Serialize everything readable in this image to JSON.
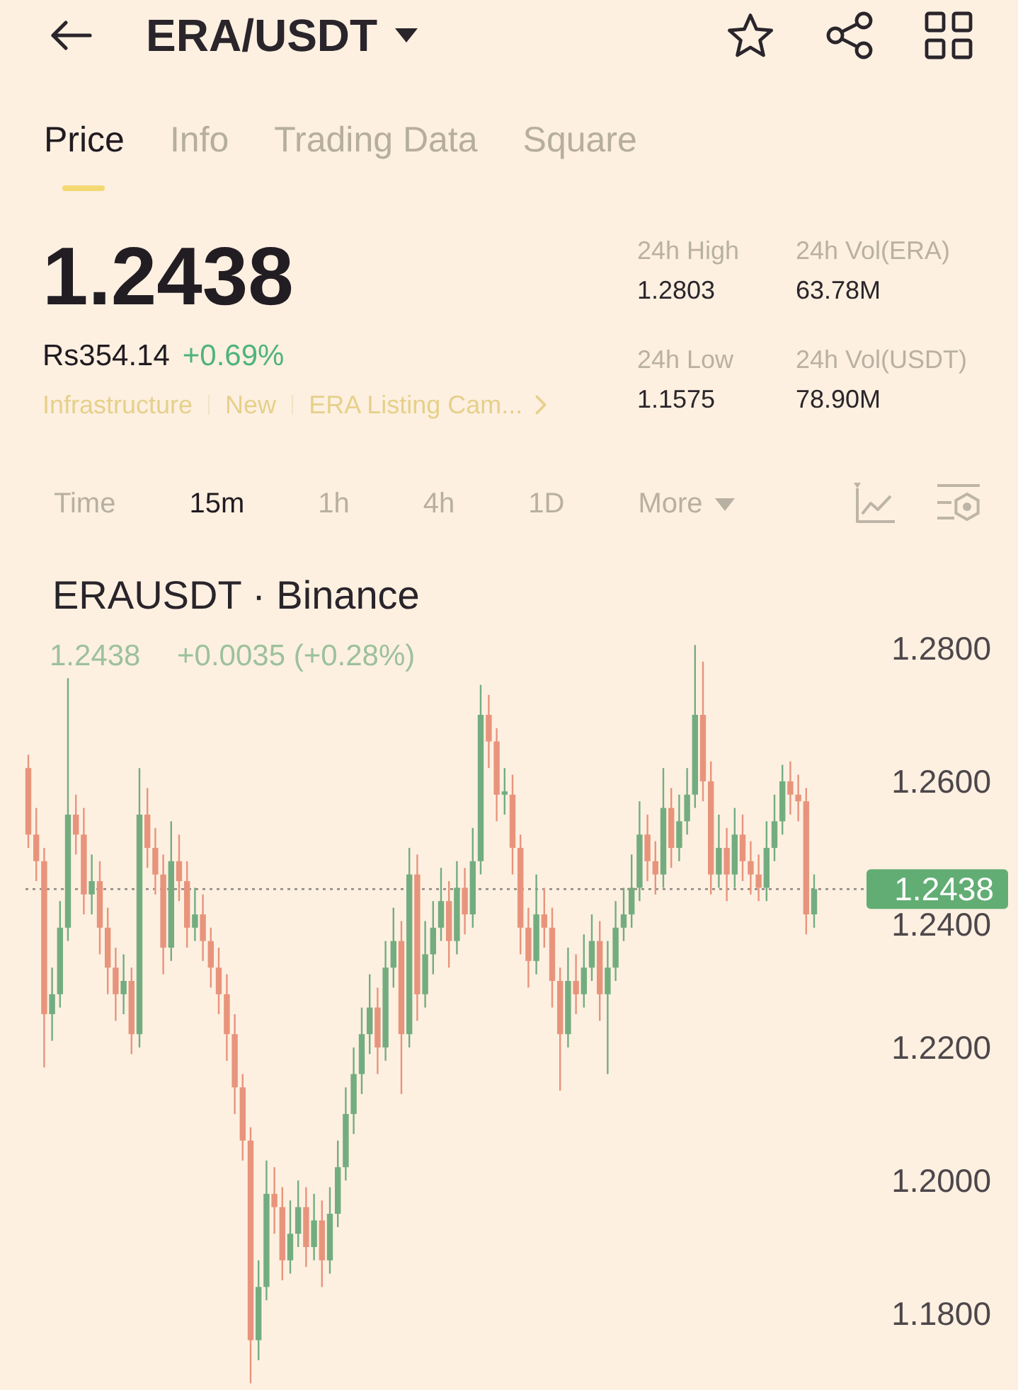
{
  "header": {
    "title": "ERA/USDT"
  },
  "tabs": [
    {
      "label": "Price",
      "selected": true
    },
    {
      "label": "Info",
      "selected": false
    },
    {
      "label": "Trading Data",
      "selected": false
    },
    {
      "label": "Square",
      "selected": false
    }
  ],
  "quote": {
    "last": "1.2438",
    "fiat": "Rs354.14",
    "change": "+0.69%",
    "tags": [
      {
        "label": "Infrastructure",
        "kind": "tag"
      },
      {
        "label": "New",
        "kind": "tag"
      },
      {
        "label": "ERA Listing Cam...",
        "kind": "link"
      }
    ],
    "stats": [
      {
        "label": "24h High",
        "value": "1.2803"
      },
      {
        "label": "24h Vol(ERA)",
        "value": "63.78M"
      },
      {
        "label": "24h Low",
        "value": "1.1575"
      },
      {
        "label": "24h Vol(USDT)",
        "value": "78.90M"
      }
    ]
  },
  "intervals": [
    {
      "label": "Time",
      "selected": false,
      "kind": "option"
    },
    {
      "label": "15m",
      "selected": true,
      "kind": "option"
    },
    {
      "label": "1h",
      "selected": false,
      "kind": "option"
    },
    {
      "label": "4h",
      "selected": false,
      "kind": "option"
    },
    {
      "label": "1D",
      "selected": false,
      "kind": "option"
    },
    {
      "label": "More",
      "selected": false,
      "kind": "menu"
    }
  ],
  "chart": {
    "last": "1.2438",
    "change": "+0.0035 (+0.28%)",
    "chart_data": {
      "type": "candlestick",
      "title": "ERAUSDT · Binance",
      "ylim": [
        1.18,
        1.28
      ],
      "yticks": [
        {
          "value": 1.28,
          "label": "1.2800"
        },
        {
          "value": 1.26,
          "label": "1.2600"
        },
        {
          "value": 1.24,
          "label": "1.2400"
        },
        {
          "value": 1.22,
          "label": "1.2200"
        },
        {
          "value": 1.2,
          "label": "1.2000"
        },
        {
          "value": 1.18,
          "label": "1.1800"
        }
      ],
      "ref_lines": [
        {
          "axis": "y",
          "value": 1.2438,
          "label": "1.2438"
        }
      ],
      "ohlc": [
        [
          1.262,
          1.264,
          1.25,
          1.252
        ],
        [
          1.252,
          1.256,
          1.245,
          1.248
        ],
        [
          1.248,
          1.25,
          1.217,
          1.225
        ],
        [
          1.225,
          1.232,
          1.221,
          1.228
        ],
        [
          1.228,
          1.242,
          1.226,
          1.238
        ],
        [
          1.238,
          1.2755,
          1.236,
          1.255
        ],
        [
          1.255,
          1.258,
          1.249,
          1.252
        ],
        [
          1.252,
          1.256,
          1.24,
          1.243
        ],
        [
          1.243,
          1.249,
          1.24,
          1.245
        ],
        [
          1.245,
          1.248,
          1.234,
          1.238
        ],
        [
          1.238,
          1.241,
          1.228,
          1.232
        ],
        [
          1.232,
          1.235,
          1.224,
          1.228
        ],
        [
          1.228,
          1.234,
          1.225,
          1.23
        ],
        [
          1.23,
          1.232,
          1.219,
          1.222
        ],
        [
          1.222,
          1.262,
          1.22,
          1.255
        ],
        [
          1.255,
          1.259,
          1.247,
          1.25
        ],
        [
          1.25,
          1.253,
          1.243,
          1.246
        ],
        [
          1.246,
          1.249,
          1.231,
          1.235
        ],
        [
          1.235,
          1.254,
          1.233,
          1.248
        ],
        [
          1.248,
          1.252,
          1.242,
          1.245
        ],
        [
          1.245,
          1.248,
          1.235,
          1.238
        ],
        [
          1.238,
          1.244,
          1.236,
          1.24
        ],
        [
          1.24,
          1.243,
          1.233,
          1.236
        ],
        [
          1.236,
          1.238,
          1.229,
          1.232
        ],
        [
          1.232,
          1.235,
          1.225,
          1.228
        ],
        [
          1.228,
          1.231,
          1.218,
          1.222
        ],
        [
          1.222,
          1.225,
          1.21,
          1.214
        ],
        [
          1.214,
          1.216,
          1.203,
          1.206
        ],
        [
          1.206,
          1.208,
          1.1695,
          1.176
        ],
        [
          1.176,
          1.188,
          1.173,
          1.184
        ],
        [
          1.184,
          1.203,
          1.182,
          1.198
        ],
        [
          1.198,
          1.202,
          1.192,
          1.196
        ],
        [
          1.196,
          1.199,
          1.185,
          1.188
        ],
        [
          1.188,
          1.197,
          1.186,
          1.192
        ],
        [
          1.192,
          1.2,
          1.19,
          1.196
        ],
        [
          1.196,
          1.199,
          1.187,
          1.19
        ],
        [
          1.19,
          1.198,
          1.188,
          1.194
        ],
        [
          1.194,
          1.197,
          1.184,
          1.188
        ],
        [
          1.188,
          1.199,
          1.186,
          1.195
        ],
        [
          1.195,
          1.206,
          1.193,
          1.202
        ],
        [
          1.202,
          1.214,
          1.2,
          1.21
        ],
        [
          1.21,
          1.22,
          1.207,
          1.216
        ],
        [
          1.216,
          1.226,
          1.213,
          1.222
        ],
        [
          1.222,
          1.231,
          1.219,
          1.226
        ],
        [
          1.226,
          1.229,
          1.216,
          1.22
        ],
        [
          1.22,
          1.236,
          1.218,
          1.232
        ],
        [
          1.232,
          1.241,
          1.229,
          1.236
        ],
        [
          1.236,
          1.239,
          1.213,
          1.222
        ],
        [
          1.222,
          1.25,
          1.22,
          1.246
        ],
        [
          1.246,
          1.249,
          1.224,
          1.228
        ],
        [
          1.228,
          1.239,
          1.226,
          1.234
        ],
        [
          1.234,
          1.242,
          1.231,
          1.238
        ],
        [
          1.238,
          1.247,
          1.236,
          1.242
        ],
        [
          1.242,
          1.245,
          1.232,
          1.236
        ],
        [
          1.236,
          1.248,
          1.234,
          1.244
        ],
        [
          1.244,
          1.247,
          1.237,
          1.24
        ],
        [
          1.24,
          1.253,
          1.238,
          1.248
        ],
        [
          1.248,
          1.2745,
          1.246,
          1.27
        ],
        [
          1.27,
          1.273,
          1.262,
          1.266
        ],
        [
          1.266,
          1.268,
          1.254,
          1.258
        ],
        [
          1.258,
          1.262,
          1.255,
          1.2585
        ],
        [
          1.258,
          1.261,
          1.246,
          1.25
        ],
        [
          1.25,
          1.252,
          1.234,
          1.238
        ],
        [
          1.238,
          1.241,
          1.229,
          1.233
        ],
        [
          1.233,
          1.246,
          1.231,
          1.24
        ],
        [
          1.24,
          1.244,
          1.235,
          1.238
        ],
        [
          1.238,
          1.241,
          1.226,
          1.23
        ],
        [
          1.23,
          1.232,
          1.2135,
          1.222
        ],
        [
          1.222,
          1.235,
          1.22,
          1.23
        ],
        [
          1.23,
          1.234,
          1.225,
          1.228
        ],
        [
          1.228,
          1.237,
          1.226,
          1.232
        ],
        [
          1.232,
          1.24,
          1.23,
          1.236
        ],
        [
          1.236,
          1.239,
          1.224,
          1.228
        ],
        [
          1.228,
          1.236,
          1.216,
          1.232
        ],
        [
          1.232,
          1.242,
          1.23,
          1.238
        ],
        [
          1.238,
          1.244,
          1.236,
          1.24
        ],
        [
          1.24,
          1.249,
          1.238,
          1.244
        ],
        [
          1.244,
          1.257,
          1.242,
          1.252
        ],
        [
          1.252,
          1.255,
          1.245,
          1.248
        ],
        [
          1.248,
          1.251,
          1.243,
          1.246
        ],
        [
          1.246,
          1.262,
          1.244,
          1.256
        ],
        [
          1.256,
          1.259,
          1.247,
          1.25
        ],
        [
          1.25,
          1.258,
          1.248,
          1.254
        ],
        [
          1.254,
          1.262,
          1.252,
          1.258
        ],
        [
          1.258,
          1.2805,
          1.256,
          1.27
        ],
        [
          1.27,
          1.278,
          1.257,
          1.26
        ],
        [
          1.26,
          1.263,
          1.243,
          1.246
        ],
        [
          1.246,
          1.255,
          1.244,
          1.25
        ],
        [
          1.25,
          1.253,
          1.242,
          1.246
        ],
        [
          1.246,
          1.256,
          1.244,
          1.252
        ],
        [
          1.252,
          1.255,
          1.245,
          1.248
        ],
        [
          1.248,
          1.251,
          1.243,
          1.246
        ],
        [
          1.246,
          1.249,
          1.242,
          1.244
        ],
        [
          1.244,
          1.254,
          1.242,
          1.25
        ],
        [
          1.25,
          1.258,
          1.248,
          1.254
        ],
        [
          1.254,
          1.2625,
          1.252,
          1.26
        ],
        [
          1.26,
          1.263,
          1.255,
          1.258
        ],
        [
          1.258,
          1.261,
          1.254,
          1.257
        ],
        [
          1.257,
          1.259,
          1.237,
          1.24
        ],
        [
          1.24,
          1.246,
          1.238,
          1.2438
        ]
      ]
    }
  }
}
